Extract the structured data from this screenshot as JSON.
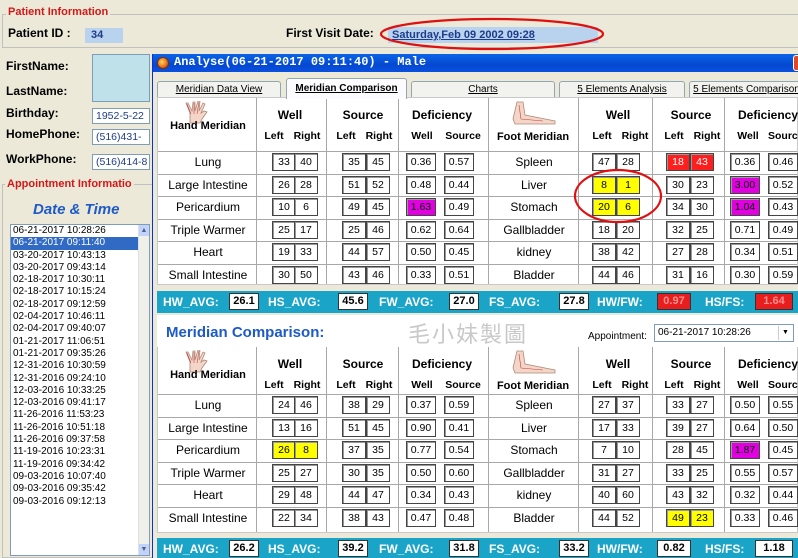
{
  "patient": {
    "section_title": "Patient Information",
    "id_label": "Patient ID :",
    "id_value": "34",
    "visit_label": "First Visit Date:",
    "visit_value": "Saturday,Feb 09 2002 09:28",
    "firstname_label": "FirstName:",
    "lastname_label": "LastName:",
    "birthday_label": "Birthday:",
    "birthday_value": "1952-5-22",
    "homephone_label": "HomePhone:",
    "homephone_value": "(516)431-",
    "workphone_label": "WorkPhone:",
    "workphone_value": "(516)414-8"
  },
  "appointment_section": {
    "title": "Appointment Informatio",
    "heading": "Date & Time",
    "items": [
      "06-21-2017 10:28:26",
      "06-21-2017 09:11:40",
      "03-20-2017 10:43:13",
      "03-20-2017 09:43:14",
      "02-18-2017 10:30:11",
      "02-18-2017 10:15:24",
      "02-18-2017 09:12:59",
      "02-04-2017 10:46:11",
      "02-04-2017 09:40:07",
      "01-21-2017 11:06:51",
      "01-21-2017 09:35:26",
      "12-31-2016 10:30:59",
      "12-31-2016 09:24:10",
      "12-03-2016 10:33:25",
      "12-03-2016 09:41:17",
      "11-26-2016 11:53:23",
      "11-26-2016 10:51:18",
      "11-26-2016 09:37:58",
      "11-19-2016 10:23:31",
      "11-19-2016 09:34:42",
      "09-03-2016 10:07:40",
      "09-03-2016 09:35:42",
      "09-03-2016 09:12:13"
    ],
    "selected_index": 1
  },
  "analyse_window": {
    "title": "Analyse(06-21-2017 09:11:40) - Male",
    "close_icon": "close-icon",
    "tabs": [
      "Meridian Data View",
      "Meridian Comparison",
      "Charts",
      "5 Elements Analysis",
      "5 Elements Comparison"
    ],
    "active_tab": 1
  },
  "headers": {
    "hand_meridian": "Hand Meridian",
    "foot_meridian": "Foot Meridian",
    "well": "Well",
    "source": "Source",
    "deficiency": "Deficiency",
    "left": "Left",
    "right": "Right",
    "well_sub": "Well",
    "source_sub": "Source"
  },
  "table1": {
    "hand_rows": [
      {
        "name": "Lung",
        "wl": "33",
        "wr": "40",
        "sl": "35",
        "sr": "45",
        "dw": "0.36",
        "ds": "0.57"
      },
      {
        "name": "Large Intestine",
        "wl": "26",
        "wr": "28",
        "sl": "51",
        "sr": "52",
        "dw": "0.48",
        "ds": "0.44"
      },
      {
        "name": "Pericardium",
        "wl": "10",
        "wr": "6",
        "sl": "49",
        "sr": "45",
        "dw": "1.63",
        "ds": "0.49"
      },
      {
        "name": "Triple Warmer",
        "wl": "25",
        "wr": "17",
        "sl": "25",
        "sr": "46",
        "dw": "0.62",
        "ds": "0.64"
      },
      {
        "name": "Heart",
        "wl": "19",
        "wr": "33",
        "sl": "44",
        "sr": "57",
        "dw": "0.50",
        "ds": "0.45"
      },
      {
        "name": "Small Intestine",
        "wl": "30",
        "wr": "50",
        "sl": "43",
        "sr": "46",
        "dw": "0.33",
        "ds": "0.51"
      }
    ],
    "foot_rows": [
      {
        "name": "Spleen",
        "wl": "47",
        "wr": "28",
        "sl": "18",
        "sr": "43",
        "dw": "0.36",
        "ds": "0.46"
      },
      {
        "name": "Liver",
        "wl": "8",
        "wr": "1",
        "sl": "30",
        "sr": "23",
        "dw": "3.00",
        "ds": "0.52"
      },
      {
        "name": "Stomach",
        "wl": "20",
        "wr": "6",
        "sl": "34",
        "sr": "30",
        "dw": "1.04",
        "ds": "0.43"
      },
      {
        "name": "Gallbladder",
        "wl": "18",
        "wr": "20",
        "sl": "32",
        "sr": "25",
        "dw": "0.71",
        "ds": "0.49"
      },
      {
        "name": "kidney",
        "wl": "38",
        "wr": "42",
        "sl": "27",
        "sr": "28",
        "dw": "0.34",
        "ds": "0.51"
      },
      {
        "name": "Bladder",
        "wl": "44",
        "wr": "46",
        "sl": "31",
        "sr": "16",
        "dw": "0.30",
        "ds": "0.59"
      }
    ],
    "avg": {
      "hw_label": "HW_AVG:",
      "hw": "26.1",
      "hs_label": "HS_AVG:",
      "hs": "45.6",
      "fw_label": "FW_AVG:",
      "fw": "27.0",
      "fs_label": "FS_AVG:",
      "fs": "27.8",
      "hwfw_label": "HW/FW:",
      "hwfw": "0.97",
      "hsfs_label": "HS/FS:",
      "hsfs": "1.64"
    }
  },
  "comparison": {
    "title": "Meridian Comparison:",
    "watermark": "毛小妹製圖",
    "appointment_label": "Appointment:",
    "appointment_value": "06-21-2017 10:28:26"
  },
  "table2": {
    "hand_rows": [
      {
        "name": "Lung",
        "wl": "24",
        "wr": "46",
        "sl": "38",
        "sr": "29",
        "dw": "0.37",
        "ds": "0.59"
      },
      {
        "name": "Large Intestine",
        "wl": "13",
        "wr": "16",
        "sl": "51",
        "sr": "45",
        "dw": "0.90",
        "ds": "0.41"
      },
      {
        "name": "Pericardium",
        "wl": "26",
        "wr": "8",
        "sl": "37",
        "sr": "35",
        "dw": "0.77",
        "ds": "0.54"
      },
      {
        "name": "Triple Warmer",
        "wl": "25",
        "wr": "27",
        "sl": "30",
        "sr": "35",
        "dw": "0.50",
        "ds": "0.60"
      },
      {
        "name": "Heart",
        "wl": "29",
        "wr": "48",
        "sl": "44",
        "sr": "47",
        "dw": "0.34",
        "ds": "0.43"
      },
      {
        "name": "Small Intestine",
        "wl": "22",
        "wr": "34",
        "sl": "38",
        "sr": "43",
        "dw": "0.47",
        "ds": "0.48"
      }
    ],
    "foot_rows": [
      {
        "name": "Spleen",
        "wl": "27",
        "wr": "37",
        "sl": "33",
        "sr": "27",
        "dw": "0.50",
        "ds": "0.55"
      },
      {
        "name": "Liver",
        "wl": "17",
        "wr": "33",
        "sl": "39",
        "sr": "27",
        "dw": "0.64",
        "ds": "0.50"
      },
      {
        "name": "Stomach",
        "wl": "7",
        "wr": "10",
        "sl": "28",
        "sr": "45",
        "dw": "1.87",
        "ds": "0.45"
      },
      {
        "name": "Gallbladder",
        "wl": "31",
        "wr": "27",
        "sl": "33",
        "sr": "25",
        "dw": "0.55",
        "ds": "0.57"
      },
      {
        "name": "kidney",
        "wl": "40",
        "wr": "60",
        "sl": "43",
        "sr": "32",
        "dw": "0.32",
        "ds": "0.44"
      },
      {
        "name": "Bladder",
        "wl": "44",
        "wr": "52",
        "sl": "49",
        "sr": "23",
        "dw": "0.33",
        "ds": "0.46"
      }
    ],
    "avg": {
      "hw_label": "HW_AVG:",
      "hw": "26.2",
      "hs_label": "HS_AVG:",
      "hs": "39.2",
      "fw_label": "FW_AVG:",
      "fw": "31.8",
      "fs_label": "FS_AVG:",
      "fs": "33.2",
      "hwfw_label": "HW/FW:",
      "hwfw": "0.82",
      "hsfs_label": "HS/FS:",
      "hsfs": "1.18"
    }
  },
  "colors": {
    "highlight_yellow": "#ffff00",
    "highlight_red": "#ff1e1e",
    "highlight_magenta": "#e000e0",
    "avg_bar": "#1aa4c8",
    "title_blue": "#1e5ac8",
    "annotation_red": "#e01010"
  }
}
